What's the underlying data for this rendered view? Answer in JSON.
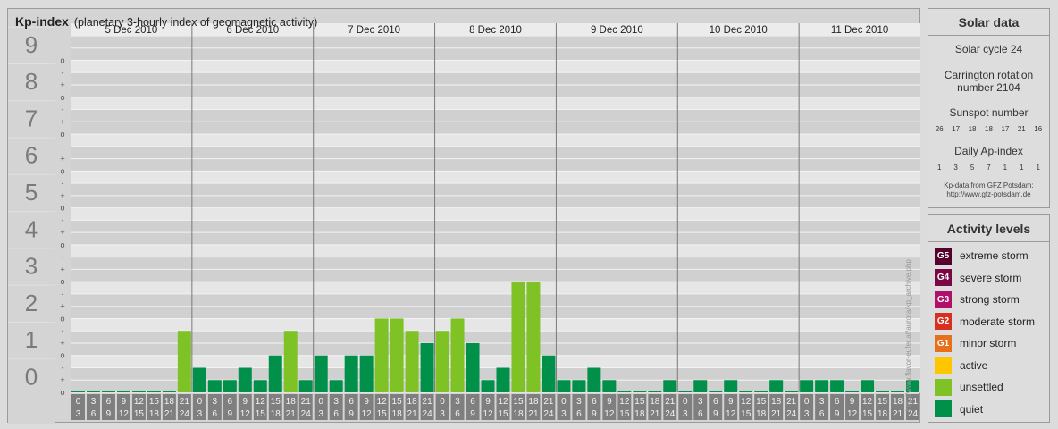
{
  "header": {
    "title": "Kp-index",
    "subtitle": "(planetary 3-hourly index of geomagnetic activity)"
  },
  "chart_data": {
    "type": "bar",
    "title": "Kp-index",
    "subtitle": "(planetary 3-hourly index of geomagnetic activity)",
    "days": [
      "5 Dec 2010",
      "6 Dec 2010",
      "7 Dec 2010",
      "8 Dec 2010",
      "9 Dec 2010",
      "10 Dec 2010",
      "11 Dec 2010"
    ],
    "interval_starts": [
      "0",
      "3",
      "6",
      "9",
      "12",
      "15",
      "18",
      "21"
    ],
    "interval_ends": [
      "3",
      "6",
      "9",
      "12",
      "15",
      "18",
      "21",
      "24"
    ],
    "y_ticks": [
      "0",
      "1",
      "2",
      "3",
      "4",
      "5",
      "6",
      "7",
      "8",
      "9"
    ],
    "sub_ticks": [
      "+",
      "o",
      "-"
    ],
    "ylim": [
      0,
      9.6667
    ],
    "values": [
      0,
      0,
      0,
      0,
      0,
      0,
      0,
      1.6667,
      0.6667,
      0.3333,
      0.3333,
      0.6667,
      0.3333,
      1,
      1.6667,
      0.3333,
      1,
      0.3333,
      1,
      1,
      2,
      2,
      1.6667,
      1.3333,
      1.6667,
      2,
      1.3333,
      0.3333,
      0.6667,
      3,
      3,
      1,
      0.3333,
      0.3333,
      0.6667,
      0.3333,
      0,
      0,
      0,
      0.3333,
      0,
      0.3333,
      0,
      0.3333,
      0,
      0,
      0.3333,
      0,
      0.3333,
      0.3333,
      0.3333,
      0,
      0.3333,
      0,
      0,
      0.3333
    ],
    "colors": {
      "quiet": "#00904a",
      "unsettled": "#7fc225"
    }
  },
  "solar": {
    "title": "Solar data",
    "cycle": "Solar cycle 24",
    "carrington_1": "Carrington rotation",
    "carrington_2": "number 2104",
    "sunspot_label": "Sunspot number",
    "sunspots": [
      "26",
      "17",
      "18",
      "18",
      "17",
      "21",
      "16"
    ],
    "ap_label": "Daily Ap-index",
    "ap": [
      "1",
      "3",
      "5",
      "7",
      "1",
      "1",
      "1"
    ],
    "credit_1": "Kp-data from GFZ Potsdam:",
    "credit_2": "http://www.gfz-potsdam.de"
  },
  "levels": {
    "title": "Activity levels",
    "items": [
      {
        "code": "G5",
        "label": "extreme storm",
        "color": "#56002e"
      },
      {
        "code": "G4",
        "label": "severe storm",
        "color": "#7a0845"
      },
      {
        "code": "G3",
        "label": "strong storm",
        "color": "#b0106a"
      },
      {
        "code": "G2",
        "label": "moderate storm",
        "color": "#d73020"
      },
      {
        "code": "G1",
        "label": "minor storm",
        "color": "#e8701a"
      },
      {
        "code": "",
        "label": "active",
        "color": "#ffc600"
      },
      {
        "code": "",
        "label": "unsettled",
        "color": "#7fc225"
      },
      {
        "code": "",
        "label": "quiet",
        "color": "#00904a"
      }
    ]
  },
  "watermark": "http://www.flavor-eufer.at/aurora/kp_archive.php"
}
